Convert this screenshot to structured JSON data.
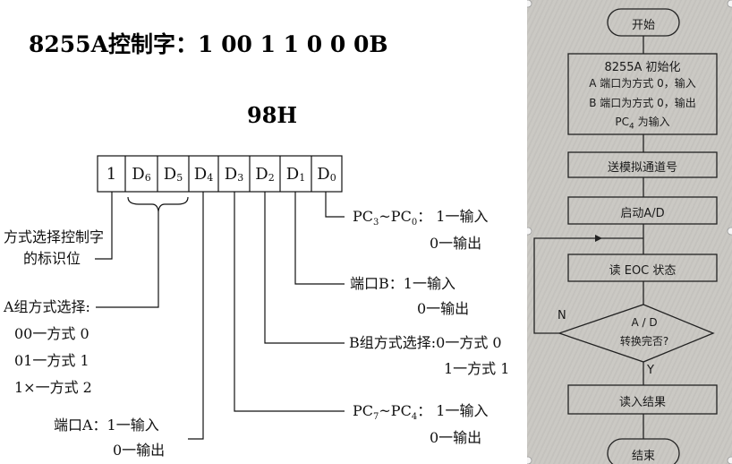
{
  "heading": "8255A控制字：1 00 1 1 0 0 0B",
  "hex": "98H",
  "register": {
    "cells": [
      {
        "main": "1",
        "sub": ""
      },
      {
        "main": "D",
        "sub": "6"
      },
      {
        "main": "D",
        "sub": "5"
      },
      {
        "main": "D",
        "sub": "4"
      },
      {
        "main": "D",
        "sub": "3"
      },
      {
        "main": "D",
        "sub": "2"
      },
      {
        "main": "D",
        "sub": "1"
      },
      {
        "main": "D",
        "sub": "0"
      }
    ]
  },
  "annotations": {
    "mode_flag": [
      "方式选择控制字",
      "的标识位"
    ],
    "group_a": [
      "A组方式选择:",
      "00一方式 0",
      "01一方式 1",
      "1×一方式 2"
    ],
    "port_a": [
      "端口A：1一输入",
      "0一输出"
    ],
    "pc_high": [
      "PC",
      "7",
      "~PC",
      "4",
      "：  1一输入",
      "0一输出"
    ],
    "group_b": [
      "B组方式选择:0一方式 0",
      "1一方式 1"
    ],
    "port_b": [
      "端口B：1一输入",
      "0一输出"
    ],
    "pc_low": [
      "PC",
      "3",
      "~PC",
      "0",
      "：  1一输入",
      "0一输出"
    ]
  },
  "flowchart": {
    "start": "开始",
    "init": [
      "8255A 初始化",
      "A 端口为方式 0，输入",
      "B 端口为方式 0，输出",
      "PC",
      "4",
      " 为输入"
    ],
    "send_channel": "送模拟通道号",
    "start_ad": "启动A/D",
    "read_eoc": "读 EOC 状态",
    "decision": [
      "A / D",
      "转换完否?"
    ],
    "no_label": "N",
    "yes_label": "Y",
    "read_result": "读入结果",
    "end": "结束"
  }
}
